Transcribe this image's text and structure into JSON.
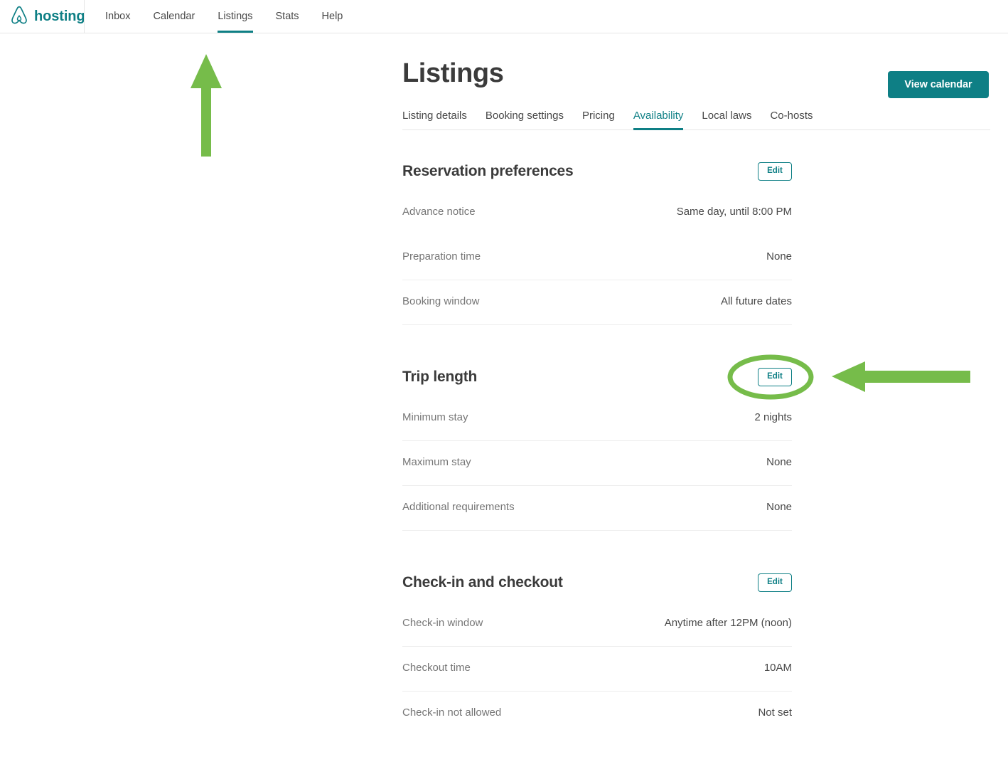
{
  "header": {
    "brand": "hosting",
    "logo_icon": "airbnb-belo-icon",
    "nav": [
      {
        "label": "Inbox",
        "active": false
      },
      {
        "label": "Calendar",
        "active": false
      },
      {
        "label": "Listings",
        "active": true
      },
      {
        "label": "Stats",
        "active": false
      },
      {
        "label": "Help",
        "active": false
      }
    ]
  },
  "page": {
    "title": "Listings",
    "view_calendar_label": "View calendar"
  },
  "tabs": [
    {
      "label": "Listing details",
      "active": false
    },
    {
      "label": "Booking settings",
      "active": false
    },
    {
      "label": "Pricing",
      "active": false
    },
    {
      "label": "Availability",
      "active": true
    },
    {
      "label": "Local laws",
      "active": false
    },
    {
      "label": "Co-hosts",
      "active": false
    }
  ],
  "sections": [
    {
      "title": "Reservation preferences",
      "edit_label": "Edit",
      "rows": [
        {
          "label": "Advance notice",
          "value": "Same day, until 8:00 PM"
        },
        {
          "label": "Preparation time",
          "value": "None"
        },
        {
          "label": "Booking window",
          "value": "All future dates"
        }
      ]
    },
    {
      "title": "Trip length",
      "edit_label": "Edit",
      "rows": [
        {
          "label": "Minimum stay",
          "value": "2 nights"
        },
        {
          "label": "Maximum stay",
          "value": "None"
        },
        {
          "label": "Additional requirements",
          "value": "None"
        }
      ]
    },
    {
      "title": "Check-in and checkout",
      "edit_label": "Edit",
      "rows": [
        {
          "label": "Check-in window",
          "value": "Anytime after 12PM (noon)"
        },
        {
          "label": "Checkout time",
          "value": "10AM"
        },
        {
          "label": "Check-in not allowed",
          "value": "Not set"
        }
      ]
    }
  ],
  "annotations": {
    "color": "#76bc4a",
    "up_arrow_target": "Listings",
    "ellipse_target": "Trip length Edit button",
    "left_arrow_target": "Trip length Edit button"
  },
  "colors": {
    "brand_teal": "#0e7f85",
    "annotation_green": "#76bc4a",
    "text_primary": "#484848",
    "text_muted": "#767676",
    "rule": "#ededed"
  }
}
